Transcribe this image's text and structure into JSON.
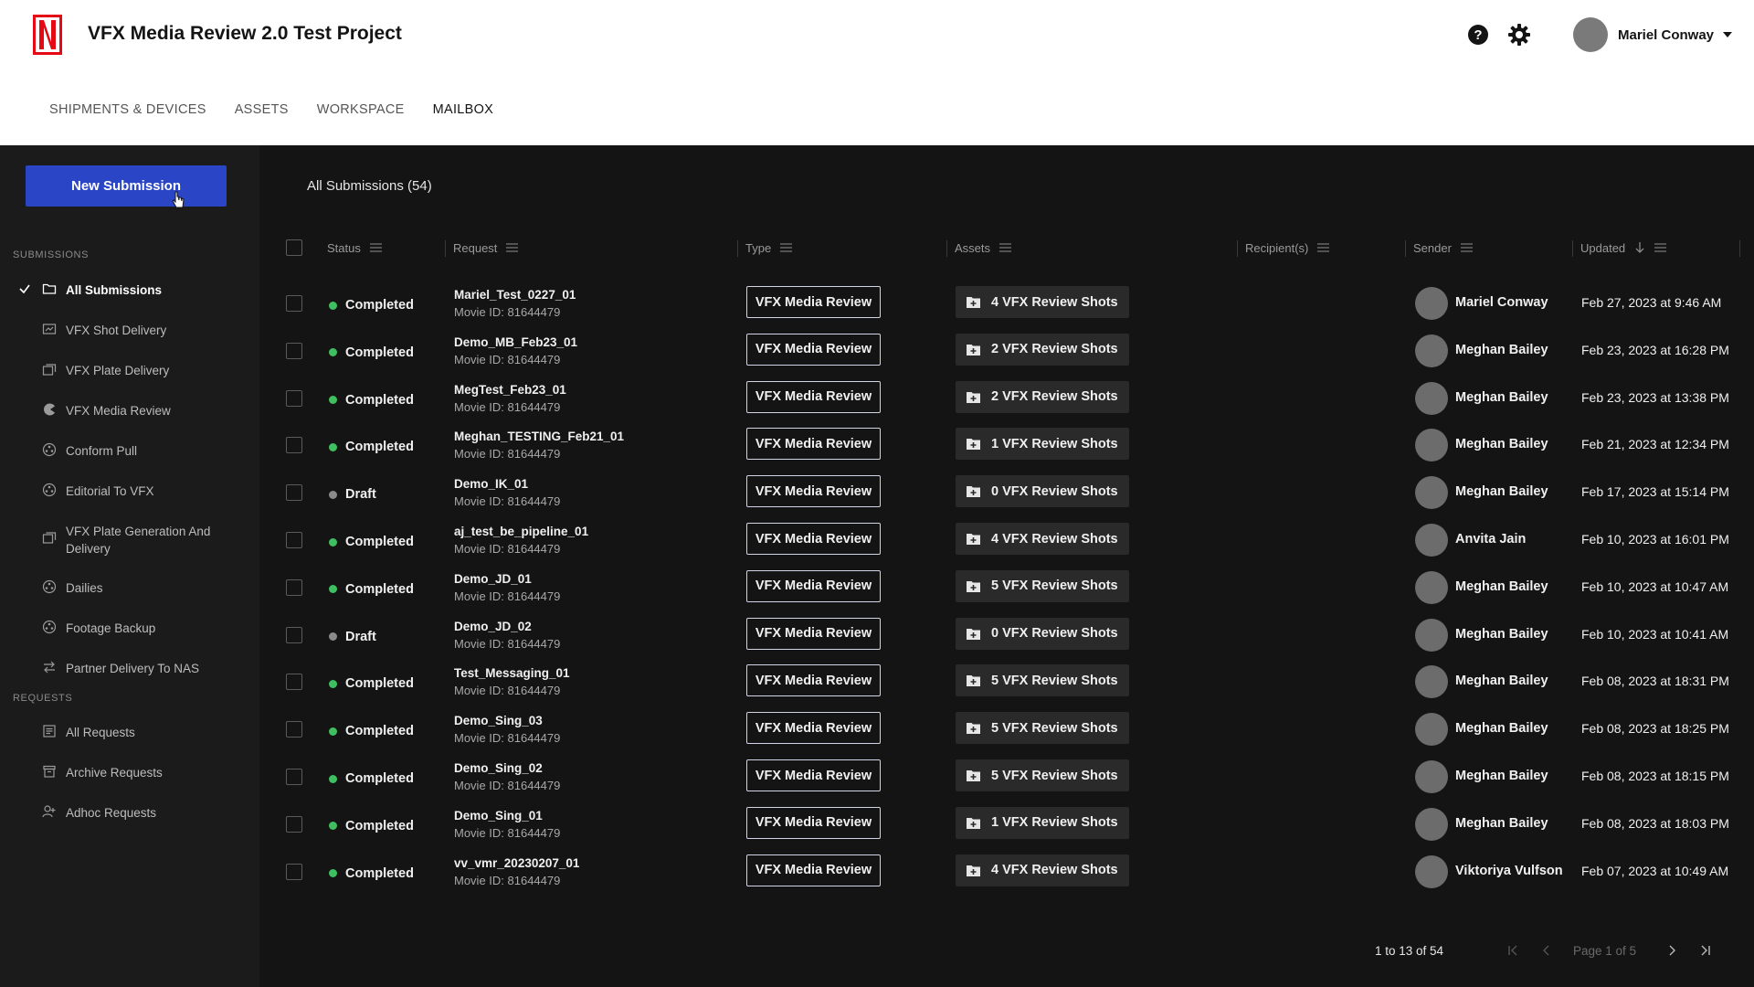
{
  "app": {
    "title": "VFX Media Review 2.0 Test Project",
    "user_name": "Mariel Conway"
  },
  "nav": {
    "tabs": [
      {
        "label": "SHIPMENTS & DEVICES"
      },
      {
        "label": "ASSETS"
      },
      {
        "label": "WORKSPACE"
      },
      {
        "label": "MAILBOX",
        "active": true
      }
    ]
  },
  "sidebar": {
    "new_submission_label": "New Submission",
    "submissions_section": "SUBMISSIONS",
    "submissions": [
      {
        "label": "All Submissions",
        "icon": "folder-icon",
        "active": true
      },
      {
        "label": "VFX Shot Delivery",
        "icon": "shot-delivery-icon"
      },
      {
        "label": "VFX Plate Delivery",
        "icon": "plate-delivery-icon"
      },
      {
        "label": "VFX Media Review",
        "icon": "media-review-icon"
      },
      {
        "label": "Conform Pull",
        "icon": "conform-icon"
      },
      {
        "label": "Editorial To VFX",
        "icon": "editorial-icon"
      },
      {
        "label": "VFX Plate Generation And Delivery",
        "icon": "plate-generation-icon"
      },
      {
        "label": "Dailies",
        "icon": "dailies-icon"
      },
      {
        "label": "Footage Backup",
        "icon": "backup-icon"
      },
      {
        "label": "Partner Delivery To NAS",
        "icon": "transfer-icon"
      }
    ],
    "requests_section": "REQUESTS",
    "requests": [
      {
        "label": "All Requests",
        "icon": "requests-icon"
      },
      {
        "label": "Archive Requests",
        "icon": "archive-icon"
      },
      {
        "label": "Adhoc Requests",
        "icon": "adhoc-icon"
      }
    ]
  },
  "main": {
    "heading": "All Submissions (54)",
    "columns": {
      "status": "Status",
      "request": "Request",
      "type": "Type",
      "assets": "Assets",
      "recipients": "Recipient(s)",
      "sender": "Sender",
      "updated": "Updated"
    },
    "colors": {
      "completed": "#3fbf5f",
      "draft": "#8a8a8a"
    },
    "rows": [
      {
        "status": "Completed",
        "name": "Mariel_Test_0227_01",
        "movie": "Movie ID: 81644479",
        "type": "VFX Media Review",
        "assets": "4 VFX Review Shots",
        "sender": "Mariel Conway",
        "updated": "Feb 27, 2023 at 9:46 AM"
      },
      {
        "status": "Completed",
        "name": "Demo_MB_Feb23_01",
        "movie": "Movie ID: 81644479",
        "type": "VFX Media Review",
        "assets": "2 VFX Review Shots",
        "sender": "Meghan Bailey",
        "updated": "Feb 23, 2023 at 16:28 PM"
      },
      {
        "status": "Completed",
        "name": "MegTest_Feb23_01",
        "movie": "Movie ID: 81644479",
        "type": "VFX Media Review",
        "assets": "2 VFX Review Shots",
        "sender": "Meghan Bailey",
        "updated": "Feb 23, 2023 at 13:38 PM"
      },
      {
        "status": "Completed",
        "name": "Meghan_TESTING_Feb21_01",
        "movie": "Movie ID: 81644479",
        "type": "VFX Media Review",
        "assets": "1 VFX Review Shots",
        "sender": "Meghan Bailey",
        "updated": "Feb 21, 2023 at 12:34 PM"
      },
      {
        "status": "Draft",
        "name": "Demo_IK_01",
        "movie": "Movie ID: 81644479",
        "type": "VFX Media Review",
        "assets": "0 VFX Review Shots",
        "sender": "Meghan Bailey",
        "updated": "Feb 17, 2023 at 15:14 PM"
      },
      {
        "status": "Completed",
        "name": "aj_test_be_pipeline_01",
        "movie": "Movie ID: 81644479",
        "type": "VFX Media Review",
        "assets": "4 VFX Review Shots",
        "sender": "Anvita Jain",
        "updated": "Feb 10, 2023 at 16:01 PM"
      },
      {
        "status": "Completed",
        "name": "Demo_JD_01",
        "movie": "Movie ID: 81644479",
        "type": "VFX Media Review",
        "assets": "5 VFX Review Shots",
        "sender": "Meghan Bailey",
        "updated": "Feb 10, 2023 at 10:47 AM"
      },
      {
        "status": "Draft",
        "name": "Demo_JD_02",
        "movie": "Movie ID: 81644479",
        "type": "VFX Media Review",
        "assets": "0 VFX Review Shots",
        "sender": "Meghan Bailey",
        "updated": "Feb 10, 2023 at 10:41 AM"
      },
      {
        "status": "Completed",
        "name": "Test_Messaging_01",
        "movie": "Movie ID: 81644479",
        "type": "VFX Media Review",
        "assets": "5 VFX Review Shots",
        "sender": "Meghan Bailey",
        "updated": "Feb 08, 2023 at 18:31 PM"
      },
      {
        "status": "Completed",
        "name": "Demo_Sing_03",
        "movie": "Movie ID: 81644479",
        "type": "VFX Media Review",
        "assets": "5 VFX Review Shots",
        "sender": "Meghan Bailey",
        "updated": "Feb 08, 2023 at 18:25 PM"
      },
      {
        "status": "Completed",
        "name": "Demo_Sing_02",
        "movie": "Movie ID: 81644479",
        "type": "VFX Media Review",
        "assets": "5 VFX Review Shots",
        "sender": "Meghan Bailey",
        "updated": "Feb 08, 2023 at 18:15 PM"
      },
      {
        "status": "Completed",
        "name": "Demo_Sing_01",
        "movie": "Movie ID: 81644479",
        "type": "VFX Media Review",
        "assets": "1 VFX Review Shots",
        "sender": "Meghan Bailey",
        "updated": "Feb 08, 2023 at 18:03 PM"
      },
      {
        "status": "Completed",
        "name": "vv_vmr_20230207_01",
        "movie": "Movie ID: 81644479",
        "type": "VFX Media Review",
        "assets": "4 VFX Review Shots",
        "sender": "Viktoriya Vulfson",
        "updated": "Feb 07, 2023 at 10:49 AM"
      }
    ]
  },
  "pagination": {
    "range": "1 to 13 of 54",
    "page": "Page 1 of 5"
  }
}
